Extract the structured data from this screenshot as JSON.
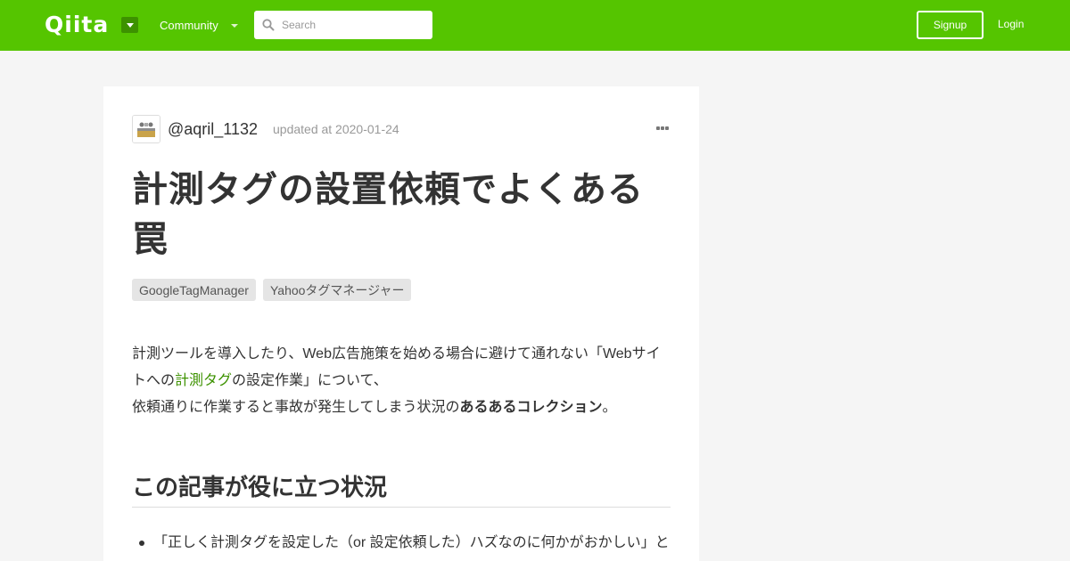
{
  "header": {
    "logo": "Qiita",
    "community_label": "Community",
    "search_placeholder": "Search",
    "signup_label": "Signup",
    "login_label": "Login",
    "brand_color": "#55c500"
  },
  "article": {
    "author": "@aqril_1132",
    "updated": "updated at 2020-01-24",
    "title": "計測タグの設置依頼でよくある罠",
    "tags": [
      "GoogleTagManager",
      "Yahooタグマネージャー"
    ],
    "intro": {
      "part1": "計測ツールを導入したり、Web広告施策を始める場合に避けて通れない「Webサイトへの",
      "link": "計測タグ",
      "part2": "の設定作業」について、",
      "part3": "依頼通りに作業すると事故が発生してしまう状況の",
      "bold": "あるあるコレクション",
      "part4": "。"
    },
    "section_heading": "この記事が役に立つ状況",
    "bullets": [
      "「正しく計測タグを設定した（or 設定依頼した）ハズなのに何かがおかしい」と"
    ]
  }
}
